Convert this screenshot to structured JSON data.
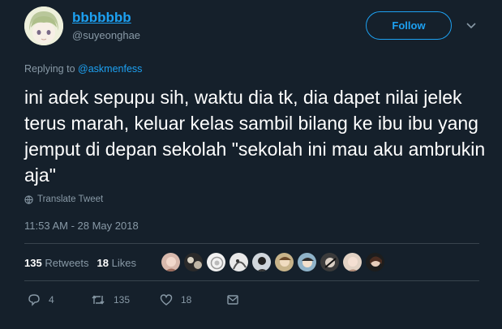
{
  "author": {
    "display_name": "bbbbbbb",
    "handle": "@suyeonghae"
  },
  "follow_label": "Follow",
  "reply": {
    "prefix": "Replying to",
    "mention": "@askmenfess"
  },
  "tweet_text": "ini adek sepupu sih, waktu dia tk, dia dapet nilai jelek terus marah, keluar kelas sambil bilang ke ibu ibu yang jemput di depan sekolah \"sekolah ini mau aku ambrukin aja\"",
  "translate_label": "Translate Tweet",
  "timestamp": "11:53 AM - 28 May 2018",
  "stats": {
    "retweets_count": "135",
    "retweets_label": "Retweets",
    "likes_count": "18",
    "likes_label": "Likes"
  },
  "actions": {
    "reply_count": "4",
    "retweet_count": "135",
    "like_count": "18"
  },
  "colors": {
    "background": "#15202b",
    "accent": "#1da1f2",
    "muted": "#8899a6",
    "divider": "#38444d"
  }
}
